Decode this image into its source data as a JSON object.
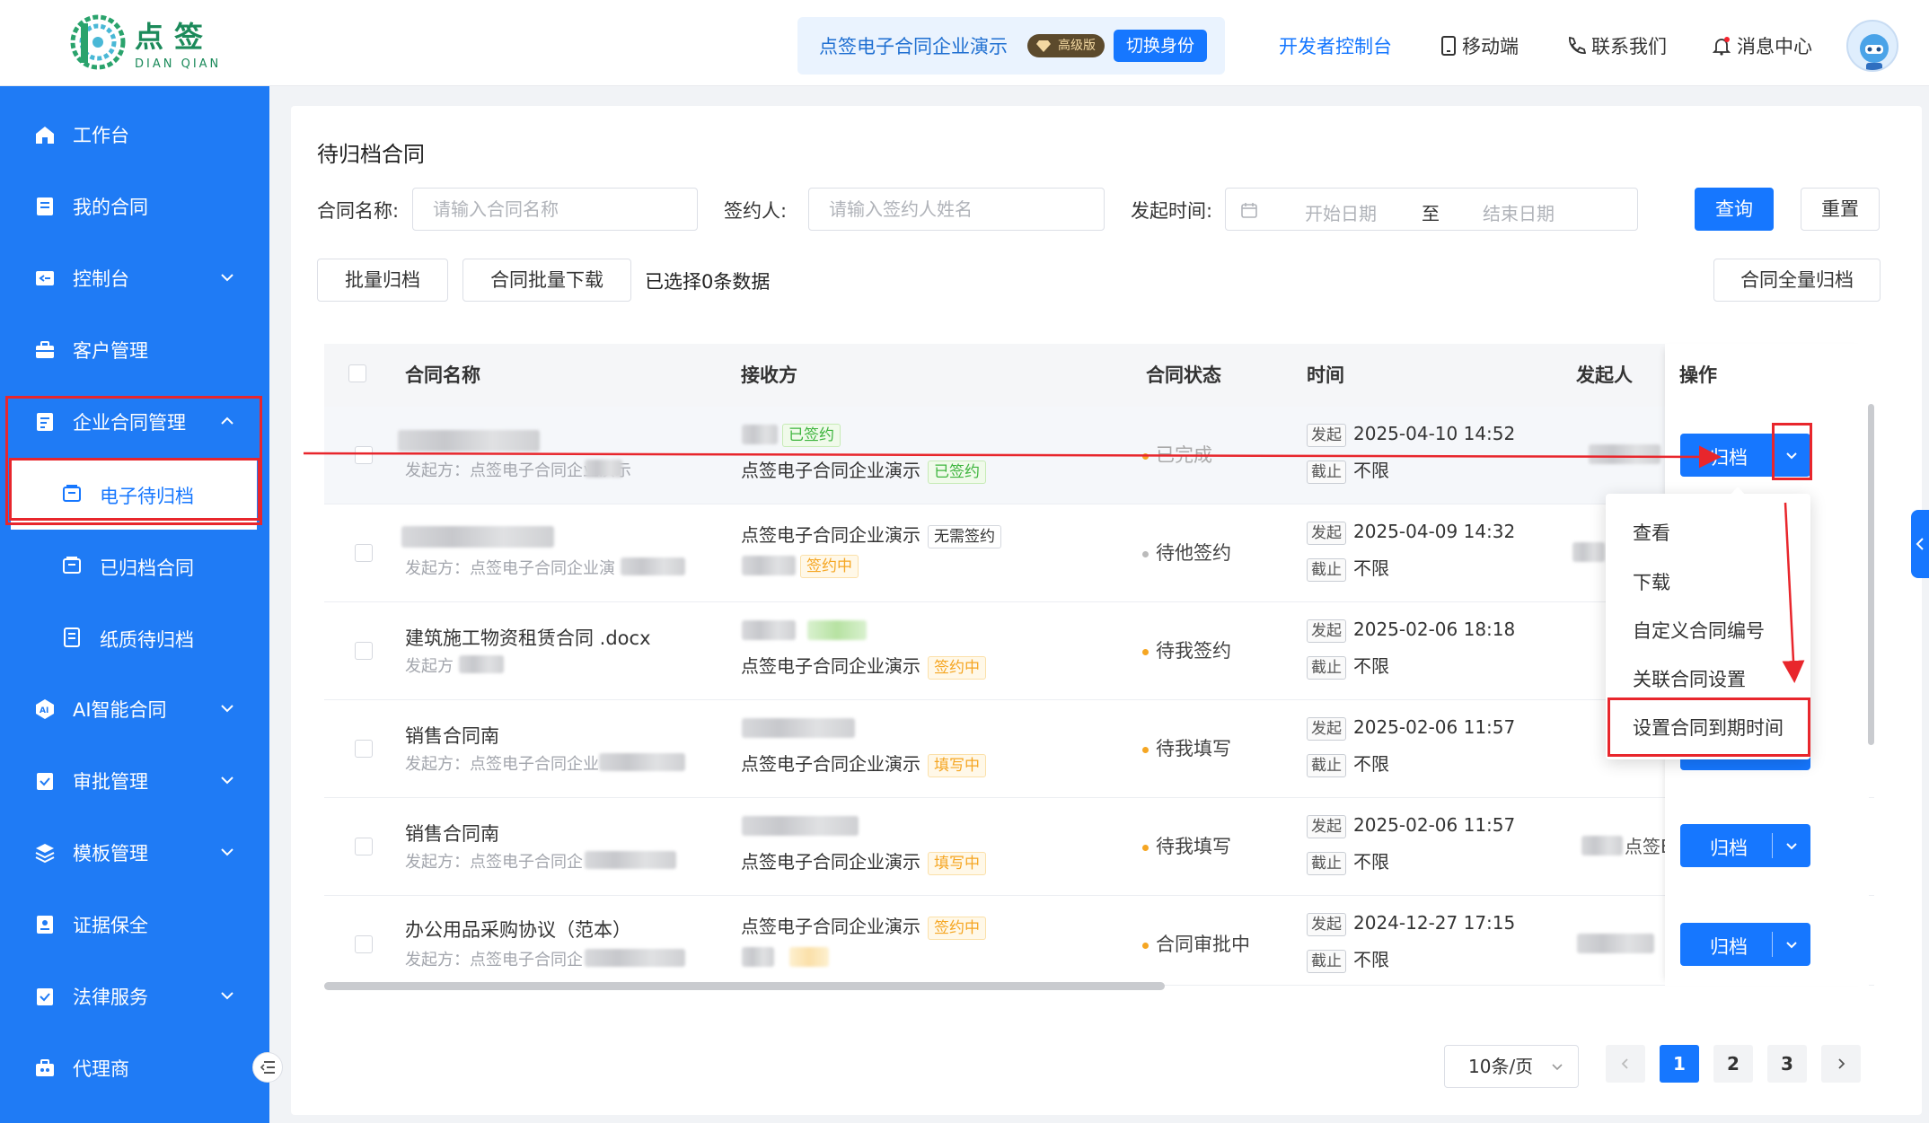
{
  "header": {
    "logo_cn": "点签",
    "logo_en": "DIAN QIAN",
    "company": "点签电子合同企业演示",
    "vip_label": "高级版",
    "switch_label": "切换身份",
    "links": {
      "dev": "开发者控制台",
      "mobile": "移动端",
      "contact": "联系我们",
      "messages": "消息中心"
    }
  },
  "sidebar": {
    "items": {
      "workbench": "工作台",
      "my_contracts": "我的合同",
      "console": "控制台",
      "customers": "客户管理",
      "enterprise": "企业合同管理",
      "e_pending": "电子待归档",
      "archived": "已归档合同",
      "paper_pending": "纸质待归档",
      "ai": "AI智能合同",
      "approval": "审批管理",
      "templates": "模板管理",
      "evidence": "证据保全",
      "legal": "法律服务",
      "agent": "代理商"
    }
  },
  "page": {
    "title": "待归档合同",
    "filters": {
      "name_label": "合同名称:",
      "name_placeholder": "请输入合同名称",
      "signer_label": "签约人:",
      "signer_placeholder": "请输入签约人姓名",
      "time_label": "发起时间:",
      "start_placeholder": "开始日期",
      "to": "至",
      "end_placeholder": "结束日期",
      "query": "查询",
      "reset": "重置"
    },
    "toolbar": {
      "batch_archive": "批量归档",
      "batch_download": "合同批量下载",
      "selected_info": "已选择0条数据",
      "archive_all": "合同全量归档"
    }
  },
  "table": {
    "headers": {
      "name": "合同名称",
      "receiver": "接收方",
      "status": "合同状态",
      "time": "时间",
      "initiator": "发起人",
      "ops": "操作"
    },
    "time_start_label": "发起",
    "time_end_label": "截止",
    "rows": [
      {
        "name": "",
        "sub": "发起方：点签电子合同企业演示",
        "recv1": "",
        "recv1_tag": "已签约",
        "recv2": "点签电子合同企业演示",
        "recv2_tag": "已签约",
        "status": "已完成",
        "start": "2025-04-10 14:52",
        "end": "不限",
        "initiator": "签"
      },
      {
        "name": "",
        "sub": "发起方：点签电子合同企业演",
        "recv1": "点签电子合同企业演示",
        "recv1_tag": "无需签约",
        "recv2": "",
        "recv2_tag": "签约中",
        "status": "待他签约",
        "start": "2025-04-09 14:32",
        "end": "不限",
        "initiator": ""
      },
      {
        "name": "建筑施工物资租赁合同 .docx",
        "sub": "发起方",
        "recv1": "",
        "recv1_tag": "",
        "recv2": "点签电子合同企业演示",
        "recv2_tag": "签约中",
        "status": "待我签约",
        "start": "2025-02-06 18:18",
        "end": "不限",
        "initiator": ""
      },
      {
        "name": "销售合同南",
        "sub": "发起方：点签电子合同企业",
        "recv1": "",
        "recv1_tag": "",
        "recv2": "点签电子合同企业演示",
        "recv2_tag": "填写中",
        "status": "待我填写",
        "start": "2025-02-06 11:57",
        "end": "不限",
        "initiator": ""
      },
      {
        "name": "销售合同南",
        "sub": "发起方：点签电子合同企",
        "recv1": "",
        "recv1_tag": "",
        "recv2": "点签电子合同企业演示",
        "recv2_tag": "填写中",
        "status": "待我填写",
        "start": "2025-02-06 11:57",
        "end": "不限",
        "initiator": "点签E"
      },
      {
        "name": "办公用品采购协议（范本）",
        "sub": "发起方：点签电子合同企",
        "recv1": "点签电子合同企业演示",
        "recv1_tag": "签约中",
        "recv2": "",
        "recv2_tag": "",
        "status": "合同审批中",
        "start": "2024-12-27 17:15",
        "end": "不限",
        "initiator": "签"
      }
    ],
    "archive_label": "归档"
  },
  "dropdown": {
    "items": [
      "查看",
      "下载",
      "自定义合同编号",
      "关联合同设置",
      "设置合同到期时间"
    ]
  },
  "pagination": {
    "page_size": "10条/页",
    "pages": [
      "1",
      "2",
      "3"
    ],
    "current": "1"
  },
  "colors": {
    "primary": "#1677ff",
    "sidebar": "#1f7bf5",
    "highlight": "#e8262c"
  }
}
